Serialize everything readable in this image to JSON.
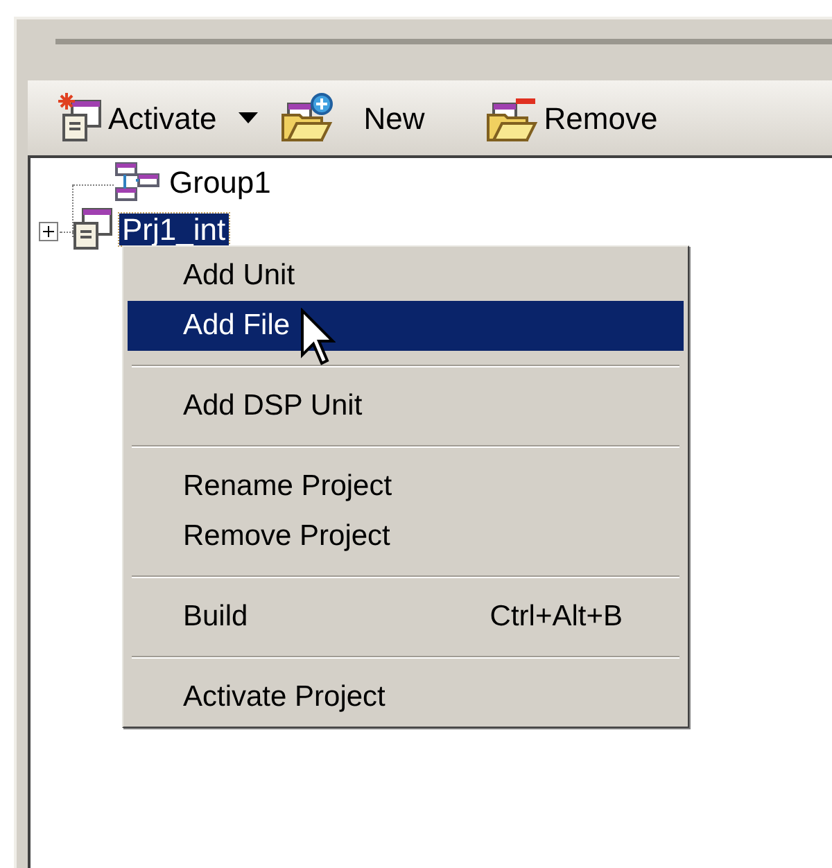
{
  "toolbar": [
    {
      "label": "Activate",
      "kind": "dropdown"
    },
    {
      "label": "New",
      "kind": "new"
    },
    {
      "label": "Remove",
      "kind": "remove"
    }
  ],
  "tree": [
    {
      "label": "Group1",
      "selected": false,
      "children": [
        {
          "label": "Prj1_int",
          "selected": true,
          "expanded": false
        }
      ]
    }
  ],
  "context_menu": {
    "items": [
      {
        "kind": "item",
        "label": "Add Unit",
        "selected": false
      },
      {
        "kind": "item",
        "label": "Add File",
        "selected": true
      },
      {
        "kind": "separator"
      },
      {
        "kind": "item",
        "label": "Add DSP Unit",
        "selected": false
      },
      {
        "kind": "separator"
      },
      {
        "kind": "item",
        "label": "Rename Project",
        "selected": false
      },
      {
        "kind": "item",
        "label": "Remove Project",
        "selected": false
      },
      {
        "kind": "separator"
      },
      {
        "kind": "item",
        "label": "Build",
        "shortcut": "Ctrl+Alt+B",
        "selected": false
      },
      {
        "kind": "separator"
      },
      {
        "kind": "item",
        "label": "Activate Project",
        "selected": false
      }
    ]
  }
}
